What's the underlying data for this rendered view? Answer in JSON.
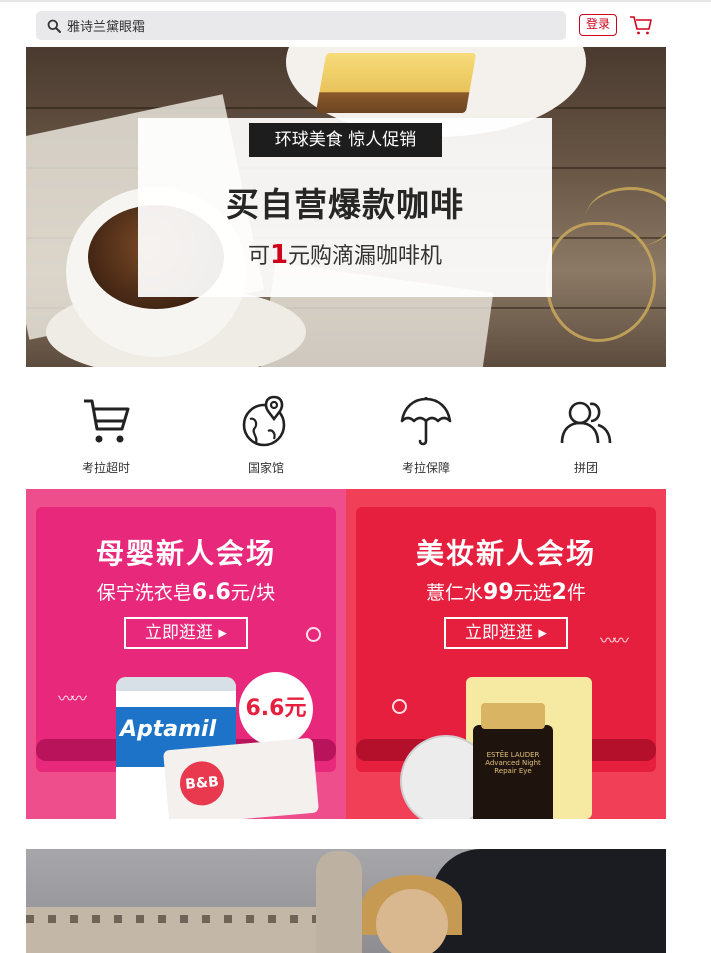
{
  "header": {
    "search_text": "雅诗兰黛眼霜",
    "login_label": "登录"
  },
  "hero_banner": {
    "tag": "环球美食 惊人促销",
    "headline": "买自营爆款咖啡",
    "sub_prefix": "可",
    "sub_highlight": "1",
    "sub_suffix": "元购滴漏咖啡机",
    "highlight_color": "#d0021b"
  },
  "categories": [
    {
      "label": "考拉超时",
      "icon": "shopping-cart-icon"
    },
    {
      "label": "国家馆",
      "icon": "globe-pin-icon"
    },
    {
      "label": "考拉保障",
      "icon": "umbrella-icon"
    },
    {
      "label": "拼团",
      "icon": "group-users-icon"
    }
  ],
  "promos": [
    {
      "title": "母婴新人会场",
      "sub_prefix": "保宁洗衣皂",
      "sub_highlight": "6.6",
      "sub_suffix": "元/块",
      "button": "立即逛逛 ▸",
      "badge": "6.6元",
      "product_brand": "Aptamil",
      "product_logo": "B&B",
      "bg_color": "#ee4e8c"
    },
    {
      "title": "美妆新人会场",
      "sub_prefix": "薏仁水",
      "sub_highlight": "99",
      "sub_middle": "元选",
      "sub_highlight2": "2",
      "sub_suffix": "件",
      "button": "立即逛逛 ▸",
      "product_label": "ESTĒE LAUDER Advanced Night Repair Eye",
      "bg_color": "#f13f57"
    }
  ],
  "colors": {
    "accent": "#d0021b",
    "search_bg": "#e9e9ec"
  }
}
